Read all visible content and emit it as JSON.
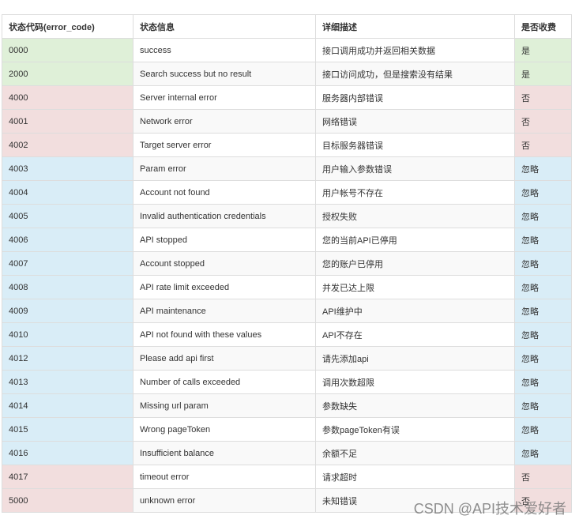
{
  "table": {
    "headers": [
      "状态代码(error_code)",
      "状态信息",
      "详细描述",
      "是否收费"
    ],
    "rows": [
      {
        "code": "0000",
        "message": "success",
        "description": "接口调用成功并返回相关数据",
        "charged": "是",
        "status": "success"
      },
      {
        "code": "2000",
        "message": "Search success but no result",
        "description": "接口访问成功，但是搜索没有结果",
        "charged": "是",
        "status": "success"
      },
      {
        "code": "4000",
        "message": "Server internal error",
        "description": "服务器内部错误",
        "charged": "否",
        "status": "danger"
      },
      {
        "code": "4001",
        "message": "Network error",
        "description": "网络错误",
        "charged": "否",
        "status": "danger"
      },
      {
        "code": "4002",
        "message": "Target server error",
        "description": "目标服务器错误",
        "charged": "否",
        "status": "danger"
      },
      {
        "code": "4003",
        "message": "Param error",
        "description": "用户输入参数错误",
        "charged": "忽略",
        "status": "info"
      },
      {
        "code": "4004",
        "message": "Account not found",
        "description": "用户帐号不存在",
        "charged": "忽略",
        "status": "info"
      },
      {
        "code": "4005",
        "message": "Invalid authentication credentials",
        "description": "授权失败",
        "charged": "忽略",
        "status": "info"
      },
      {
        "code": "4006",
        "message": "API stopped",
        "description": "您的当前API已停用",
        "charged": "忽略",
        "status": "info"
      },
      {
        "code": "4007",
        "message": "Account stopped",
        "description": "您的账户已停用",
        "charged": "忽略",
        "status": "info"
      },
      {
        "code": "4008",
        "message": "API rate limit exceeded",
        "description": "并发已达上限",
        "charged": "忽略",
        "status": "info"
      },
      {
        "code": "4009",
        "message": "API maintenance",
        "description": "API维护中",
        "charged": "忽略",
        "status": "info"
      },
      {
        "code": "4010",
        "message": "API not found with these values",
        "description": "API不存在",
        "charged": "忽略",
        "status": "info"
      },
      {
        "code": "4012",
        "message": "Please add api first",
        "description": "请先添加api",
        "charged": "忽略",
        "status": "info"
      },
      {
        "code": "4013",
        "message": "Number of calls exceeded",
        "description": "调用次数超限",
        "charged": "忽略",
        "status": "info"
      },
      {
        "code": "4014",
        "message": "Missing url param",
        "description": "参数缺失",
        "charged": "忽略",
        "status": "info"
      },
      {
        "code": "4015",
        "message": "Wrong pageToken",
        "description": "参数pageToken有误",
        "charged": "忽略",
        "status": "info"
      },
      {
        "code": "4016",
        "message": "Insufficient balance",
        "description": "余额不足",
        "charged": "忽略",
        "status": "info"
      },
      {
        "code": "4017",
        "message": "timeout error",
        "description": "请求超时",
        "charged": "否",
        "status": "danger"
      },
      {
        "code": "5000",
        "message": "unknown error",
        "description": "未知错误",
        "charged": "否",
        "status": "danger"
      }
    ]
  },
  "watermark": "CSDN @API技术爱好者"
}
